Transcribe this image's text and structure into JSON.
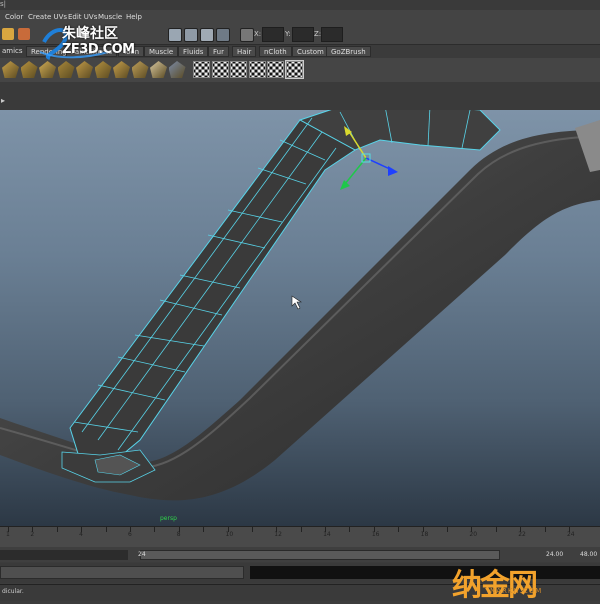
{
  "topbar": {
    "fragment": "s|"
  },
  "menubar": {
    "items": [
      "Color",
      "Create UVs",
      "Edit UVs",
      "Muscle",
      "Help"
    ]
  },
  "statusline": {
    "coords": [
      {
        "label": "X:",
        "value": ""
      },
      {
        "label": "Y:",
        "value": ""
      },
      {
        "label": "Z:",
        "value": ""
      }
    ]
  },
  "watermark_top": {
    "line1": "朱峰社区",
    "line2": "ZF3D.COM"
  },
  "shelf": {
    "tabs": [
      "amics",
      "Rendering",
      "PaintEffects",
      "Toon",
      "Muscle",
      "Fluids",
      "Fur",
      "Hair",
      "nCloth",
      "Custom",
      "GoZBrush"
    ],
    "icons": [
      "tex-cube-icon",
      "tex-sphere-icon",
      "tex-plane-icon",
      "tex-tile-icon",
      "tex-box-icon",
      "tex-cyl-icon",
      "tex-cone-icon",
      "tex-disc-icon",
      "tex-ramp-icon",
      "tex-grid-icon",
      "checker-icon",
      "checker-icon",
      "checker-icon",
      "checker-icon",
      "checker-icon",
      "checker-box-icon"
    ]
  },
  "viewport": {
    "marker": "persp"
  },
  "timeslider": {
    "ticks": [
      "1",
      "2",
      "4",
      "6",
      "8",
      "10",
      "12",
      "14",
      "16",
      "18",
      "20",
      "22",
      "24"
    ],
    "current_frame": "24"
  },
  "range": {
    "start_end_left": "24",
    "end_value": "24.00",
    "max_value": "48.00"
  },
  "helpline": {
    "text": "dicular."
  },
  "watermark_bottom": {
    "line1": "纳金网",
    "line2": "NARKII.COM"
  },
  "colors": {
    "wireframe": "#58d3e8",
    "mesh": "#3b3b3b",
    "accent": "#f2a22c"
  }
}
